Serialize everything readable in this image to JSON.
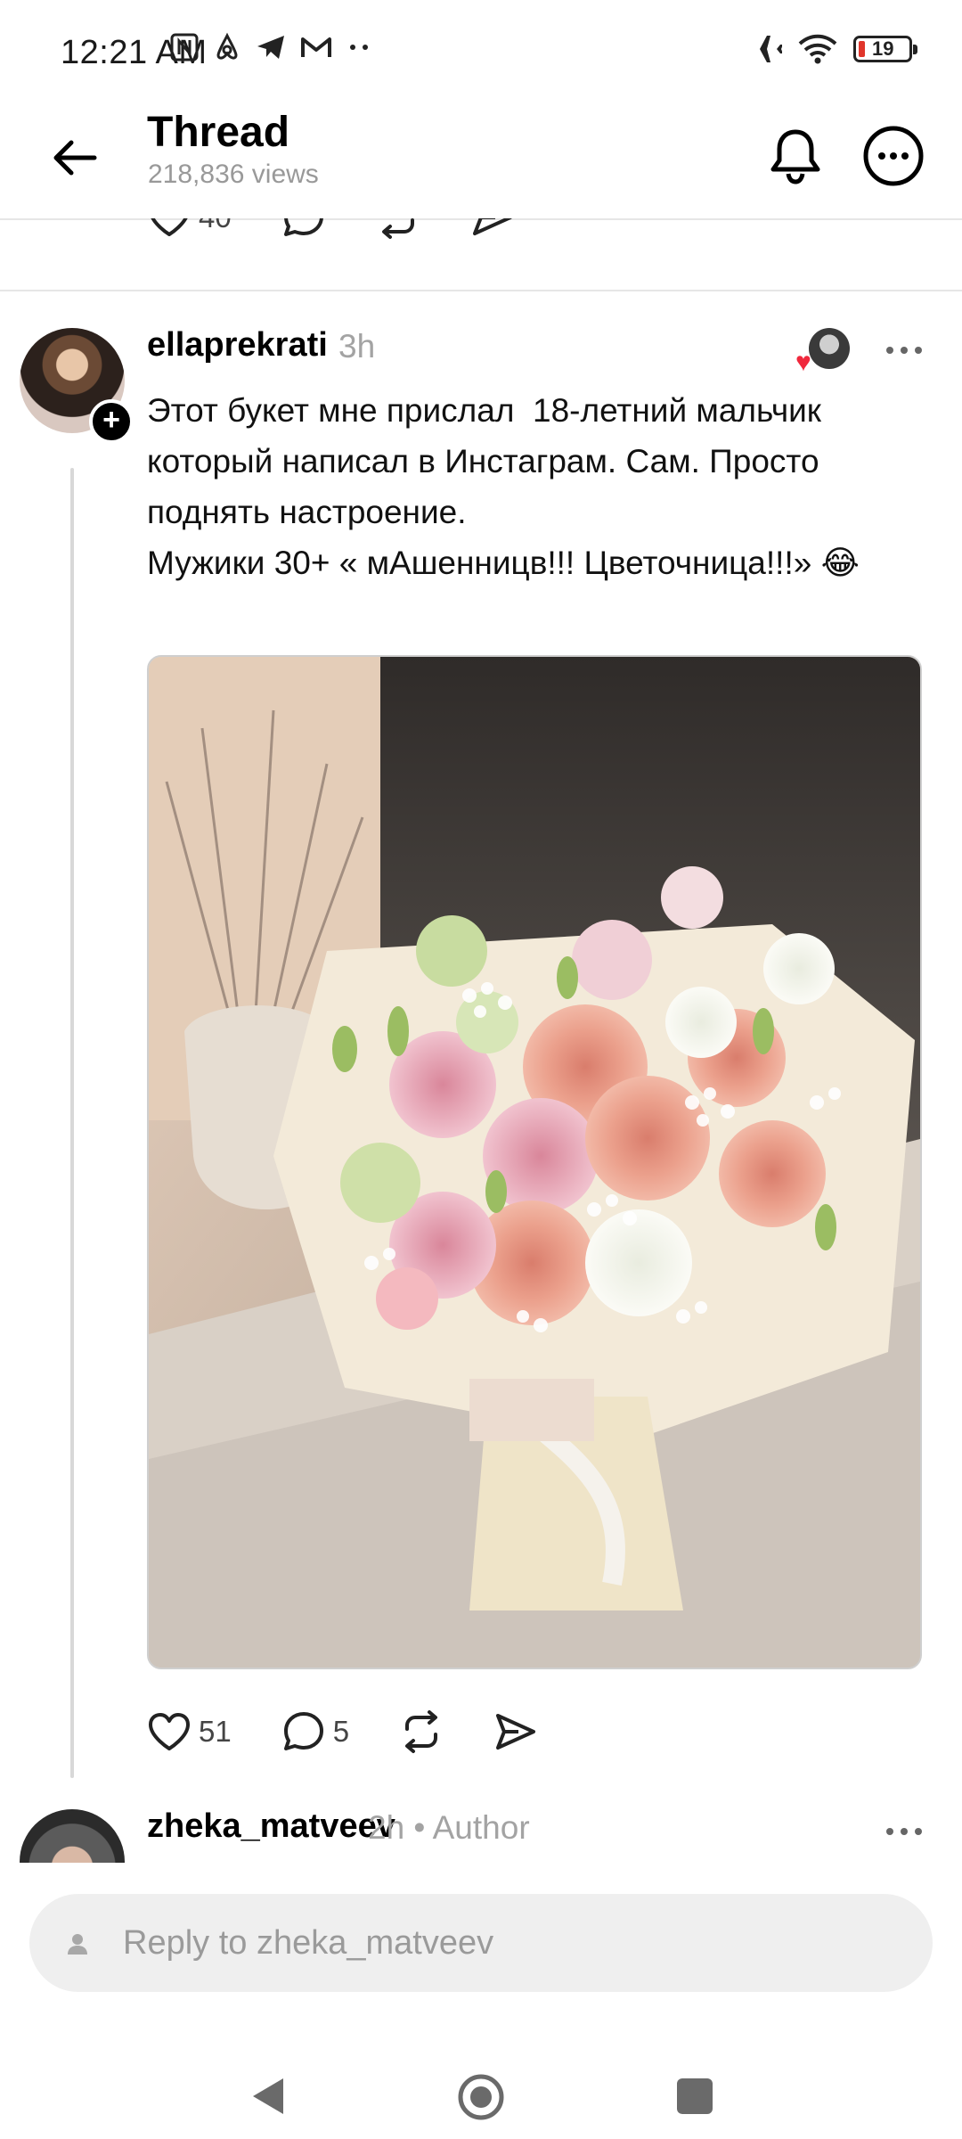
{
  "status_bar": {
    "time": "12:21 AM",
    "battery_level": "19",
    "notification_icons": [
      "nfc-icon",
      "airbnb-icon",
      "telegram-icon",
      "gmail-icon",
      "more-notifications-icon"
    ],
    "system_icons": [
      "airplane-mode-icon",
      "wifi-icon",
      "battery-icon"
    ]
  },
  "header": {
    "title": "Thread",
    "views": "218,836 views"
  },
  "previous_post_actions": {
    "like_count": "40"
  },
  "post": {
    "username": "ellaprekrati",
    "time": "3h",
    "text": "Этот букет мне прислал  18-летний мальчик который написал в Инстаграм. Сам. Просто поднять настроение.\nМужики 30+ « мАшенницв!!! Цветочница!!!» 😂",
    "image_alt": "Bouquet of peach and pink roses with lisianthus and baby's breath",
    "like_count": "51",
    "reply_count": "5"
  },
  "reply": {
    "username": "zheka_matveev",
    "meta": "2h • Author"
  },
  "composer": {
    "placeholder": "Reply to zheka_matveev"
  },
  "colors": {
    "accent_heart": "#f0283c",
    "muted_text": "#a3a3a3",
    "divider": "#e6e6e6"
  }
}
